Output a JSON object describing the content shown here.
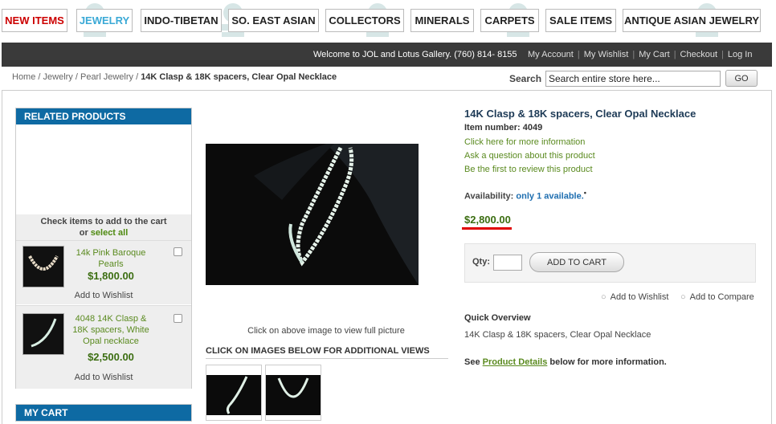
{
  "topnav": {
    "items": [
      {
        "label": "NEW ITEMS",
        "color": "#cc0000"
      },
      {
        "label": "JEWELRY",
        "color": "#1e8bc3"
      },
      {
        "label": "INDO-TIBETAN",
        "color": "#222222"
      },
      {
        "label": "SO. EAST ASIAN",
        "color": "#222222"
      },
      {
        "label": "COLLECTORS",
        "color": "#222222"
      },
      {
        "label": "MINERALS",
        "color": "#222222"
      },
      {
        "label": "CARPETS",
        "color": "#222222"
      },
      {
        "label": "SALE ITEMS",
        "color": "#222222"
      },
      {
        "label": "ANTIQUE ASIAN JEWELRY",
        "color": "#222222"
      }
    ]
  },
  "header": {
    "welcome": "Welcome to JOL and Lotus Gallery. (760) 814- 8155",
    "links": [
      "My Account",
      "My Wishlist",
      "My Cart",
      "Checkout",
      "Log In"
    ]
  },
  "breadcrumb": {
    "items": [
      "Home",
      "Jewelry",
      "Pearl Jewelry"
    ],
    "current": "14K Clasp & 18K spacers, Clear Opal Necklace"
  },
  "search": {
    "label": "Search",
    "value": "Search entire store here...",
    "button": "GO"
  },
  "sidebar": {
    "related_title": "RELATED PRODUCTS",
    "check_text": "Check items to add to the cart",
    "check_or": "or",
    "select_all": "select all",
    "items": [
      {
        "name": "14k Pink Baroque Pearls",
        "price": "$1,800.00",
        "wishlist": "Add to Wishlist"
      },
      {
        "name": "4048 14K Clasp & 18K spacers, White Opal necklace",
        "price": "$2,500.00",
        "wishlist": "Add to Wishlist"
      }
    ],
    "cart_title": "MY CART"
  },
  "gallery": {
    "caption": "Click on above image to view full picture",
    "views_title": "CLICK ON IMAGES BELOW FOR ADDITIONAL VIEWS"
  },
  "product": {
    "title": "14K Clasp & 18K spacers, Clear Opal Necklace",
    "item_number": "Item number: 4049",
    "links": [
      "Click here for more information",
      "Ask a question about this product",
      "Be the first to review this product"
    ],
    "availability_label": "Availability:",
    "availability_value": "only 1 available.",
    "price": "$2,800.00",
    "qty_label": "Qty:",
    "qty_value": "",
    "add_to_cart": "ADD TO CART",
    "add_to_wishlist": "Add to Wishlist",
    "add_to_compare": "Add to Compare",
    "quick_overview_title": "Quick Overview",
    "quick_overview_text": "14K Clasp & 18K spacers, Clear Opal Necklace",
    "see": "See",
    "product_details": "Product Details",
    "see_suffix": "below for more information."
  },
  "colors": {
    "accent_blue": "#0e6aa3",
    "price_green": "#3c6e12",
    "link_green": "#5a8a1f",
    "header_bar": "#3a3a3a",
    "highlight_red": "#e00000"
  }
}
